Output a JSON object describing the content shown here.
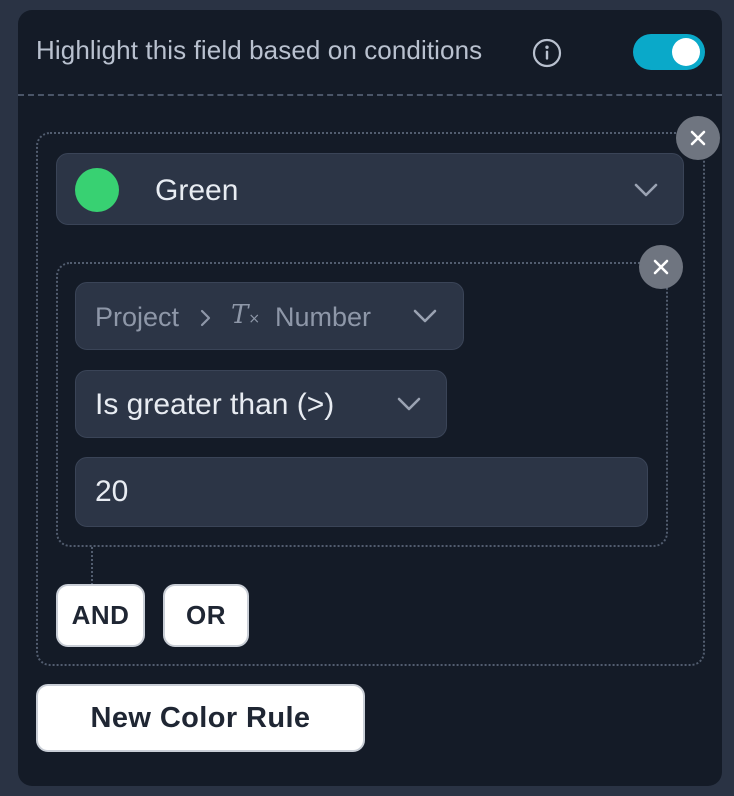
{
  "header": {
    "title": "Highlight this field based on conditions",
    "info_icon": "info-circle-icon",
    "toggle_on": true,
    "accent_color": "#0aa9c9"
  },
  "rule": {
    "color_label": "Green",
    "color_value": "#38d172",
    "remove_icon": "close-icon",
    "condition": {
      "field_path": [
        "Project",
        "Number"
      ],
      "field_type_icon": "text-format-icon",
      "operator_label": "Is greater than (>)",
      "value": "20",
      "remove_icon": "close-icon"
    },
    "logic_buttons": {
      "and_label": "AND",
      "or_label": "OR"
    }
  },
  "footer": {
    "new_rule_label": "New Color Rule"
  }
}
